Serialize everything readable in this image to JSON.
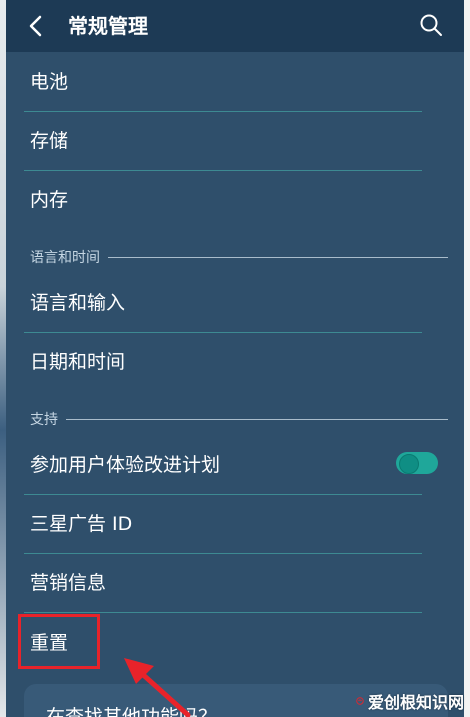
{
  "header": {
    "title": "常规管理",
    "back_icon": "chevron-left-icon",
    "search_icon": "search-icon"
  },
  "menu": {
    "battery": "电池",
    "storage": "存储",
    "memory": "内存",
    "language_input": "语言和输入",
    "date_time": "日期和时间",
    "experience_program": "参加用户体验改进计划",
    "ad_id": "三星广告 ID",
    "marketing": "营销信息",
    "reset": "重置"
  },
  "sections": {
    "language_time": "语言和时间",
    "support": "支持"
  },
  "toggle": {
    "experience_program_enabled": true
  },
  "bottom_card": {
    "text": "在查找其他功能吗？"
  },
  "watermark": {
    "text": "爱创根知识网"
  },
  "colors": {
    "background": "#2f4f6b",
    "header": "#1d3a55",
    "divider": "#3d8a92",
    "toggle_on": "#1fa79a",
    "highlight": "#e8232a"
  }
}
